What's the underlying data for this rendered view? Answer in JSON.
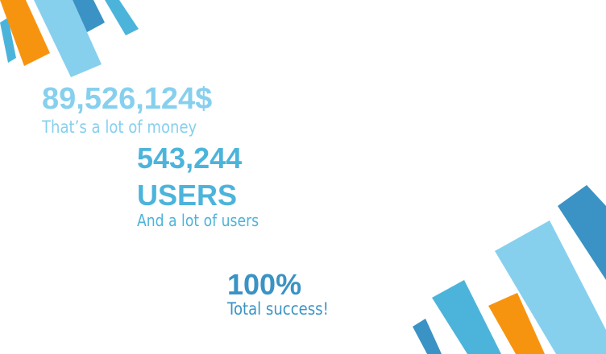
{
  "stats": [
    {
      "value": "89,526,124$",
      "caption": "That’s a lot of money"
    },
    {
      "value": "543,244",
      "value_line2": "USERS",
      "caption": "And a lot of users"
    },
    {
      "value": "100%",
      "caption": "Total success!"
    }
  ],
  "colors": {
    "light_blue": "#86d0ee",
    "mid_blue": "#4cb4db",
    "dark_blue": "#3a93c4",
    "orange": "#f7940f"
  }
}
